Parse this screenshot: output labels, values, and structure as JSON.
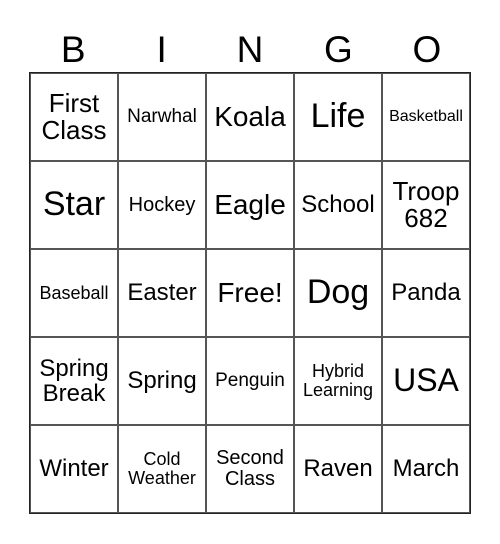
{
  "header": [
    "B",
    "I",
    "N",
    "G",
    "O"
  ],
  "cells": [
    "First Class",
    "Narwhal",
    "Koala",
    "Life",
    "Basketball",
    "Star",
    "Hockey",
    "Eagle",
    "School",
    "Troop 682",
    "Baseball",
    "Easter",
    "Free!",
    "Dog",
    "Panda",
    "Spring Break",
    "Spring",
    "Penguin",
    "Hybrid Learning",
    "USA",
    "Winter",
    "Cold Weather",
    "Second Class",
    "Raven",
    "March"
  ]
}
